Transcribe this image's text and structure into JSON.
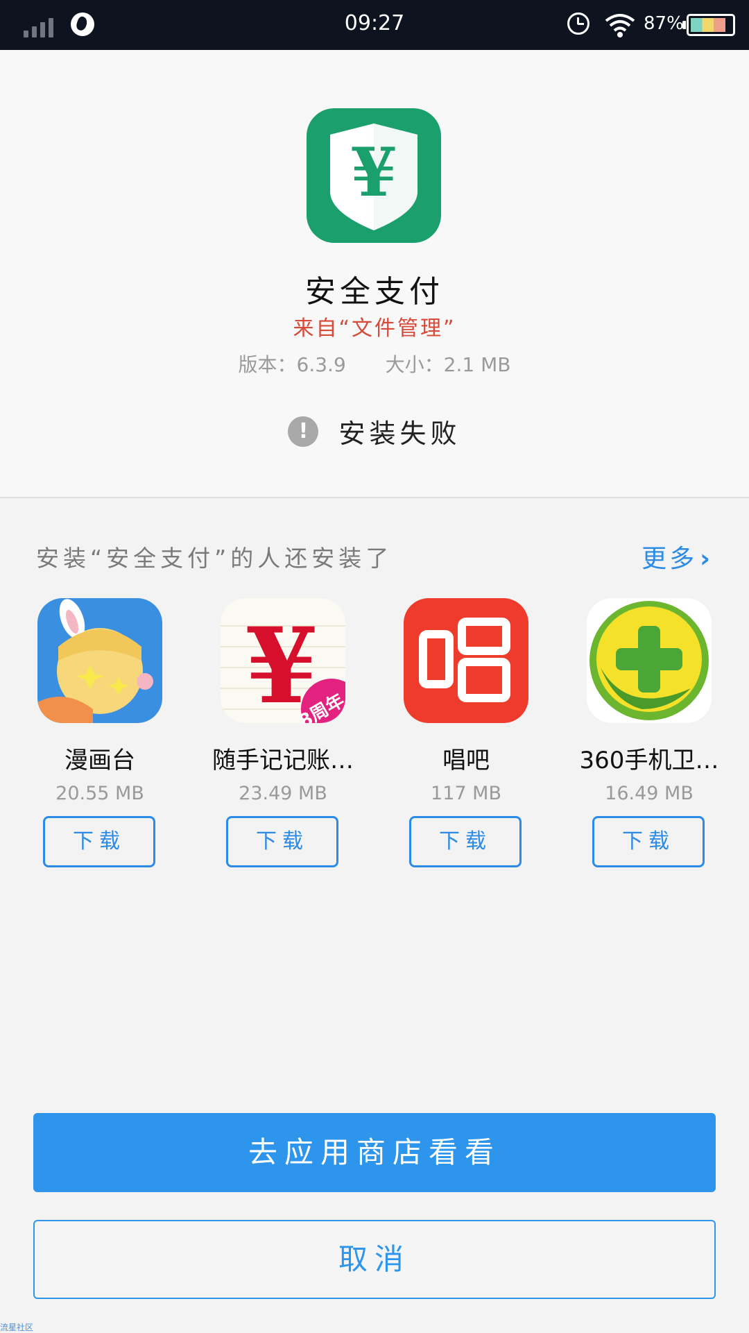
{
  "status_bar": {
    "time": "09:27",
    "battery": "87%",
    "battery_level": 0.87
  },
  "app": {
    "name": "安全支付",
    "source": "来自“文件管理”",
    "version": "版本：6.3.9",
    "size": "大小：2.1 MB",
    "status": "安装失败",
    "icon_color": "#1ba06d"
  },
  "recommend": {
    "title": "安装“安全支付”的人还安装了",
    "more_label": "更多",
    "items": [
      {
        "name": "漫画台",
        "size": "20.55 MB",
        "button": "下载"
      },
      {
        "name": "随手记记账…",
        "size": "23.49 MB",
        "button": "下载"
      },
      {
        "name": "唱吧",
        "size": "117 MB",
        "button": "下载"
      },
      {
        "name": "360手机卫…",
        "size": "16.49 MB",
        "button": "下载"
      }
    ]
  },
  "actions": {
    "store_label": "去应用商店看看",
    "cancel_label": "取消"
  },
  "watermark": "流星社区",
  "accent_color": "#2b8be6"
}
